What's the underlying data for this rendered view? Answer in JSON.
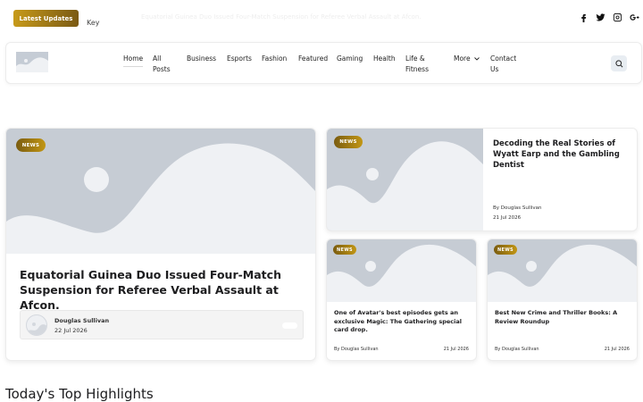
{
  "topbar": {
    "badge_label": "Latest Updates",
    "ticker_key": "Key",
    "ticker_text": "Equatorial Guinea Duo Issued Four-Match Suspension for Referee Verbal Assault at Afcon."
  },
  "social_icons": [
    "facebook-icon",
    "twitter-icon",
    "instagram-icon",
    "google-plus-icon"
  ],
  "nav": {
    "items": [
      {
        "line1": "Home",
        "line2": ""
      },
      {
        "line1": "All",
        "line2": "Posts"
      },
      {
        "line1": "Business",
        "line2": ""
      },
      {
        "line1": "Esports",
        "line2": ""
      },
      {
        "line1": "Fashion",
        "line2": ""
      },
      {
        "line1": "Featured",
        "line2": ""
      },
      {
        "line1": "Gaming",
        "line2": ""
      },
      {
        "line1": "Health",
        "line2": ""
      },
      {
        "line1": "Life &",
        "line2": "Fitness"
      },
      {
        "line1": "More",
        "line2": ""
      },
      {
        "line1": "Contact",
        "line2": "Us"
      }
    ]
  },
  "hero": {
    "tag": "NEWS",
    "title": "Equatorial Guinea Duo Issued Four-Match Suspension for Referee Verbal Assault at Afcon.",
    "author": "Douglas Sullivan",
    "date": "22 Jul 2026"
  },
  "side_feature": {
    "tag": "NEWS",
    "title": "Decoding the Real Stories of Wyatt Earp and the Gambling Dentist",
    "byline": "By Douglas Sullivan",
    "date": "21 Jul 2026"
  },
  "small_cards": [
    {
      "tag": "NEWS",
      "title": "One of Avatar's best episodes gets an exclusive Magic: The Gathering special card drop.",
      "byline": "By Douglas Sullivan",
      "date": "21 Jul 2026"
    },
    {
      "tag": "NEWS",
      "title": "Best New Crime and Thriller Books: A Review Roundup",
      "byline": "By Douglas Sullivan",
      "date": "21 Jul 2026"
    }
  ],
  "section": {
    "heading": "Today's Top Highlights"
  },
  "colors": {
    "accent_gold": "#c29614",
    "placeholder": "#c6ccd4",
    "hill": "#eff1f4"
  }
}
